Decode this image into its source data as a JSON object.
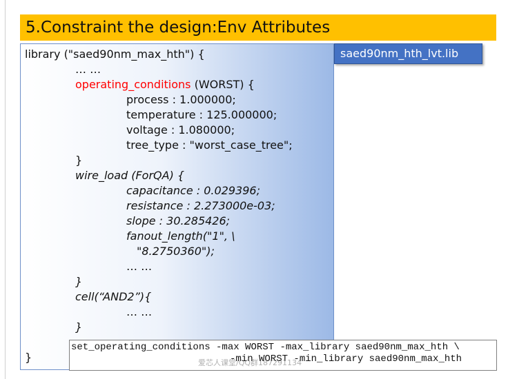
{
  "title": "5.Constraint the design:Env Attributes",
  "file_badge": "saed90nm_hth_lvt.lib",
  "code": {
    "l1": "library (\"saed90nm_max_hth\") {",
    "l2": "… …",
    "l3_kw": "operating_conditions",
    "l3_rest": " (WORST) {",
    "l4": "process : 1.000000;",
    "l5": "temperature : 125.000000;",
    "l6": "voltage : 1.080000;",
    "l7": "tree_type : \"worst_case_tree\";",
    "l8": "}",
    "l9": "wire_load (ForQA) {",
    "l10": "capacitance : 0.029396;",
    "l11": "resistance : 2.273000e-03;",
    "l12": "slope : 30.285426;",
    "l13": "fanout_length(\"1\", \\",
    "l14": "\"8.2750360\");",
    "l15": "… …",
    "l16": "}",
    "l17": "cell(“AND2”){",
    "l18": "… …",
    "l19": "}",
    "l20": "}"
  },
  "command": {
    "line1": "set_operating_conditions -max WORST -max_library saed90nm_max_hth \\",
    "line2": "-min WORST -min_library saed90nm_max_hth"
  },
  "watermark": "爱芯人课堂/QQ群187291134"
}
